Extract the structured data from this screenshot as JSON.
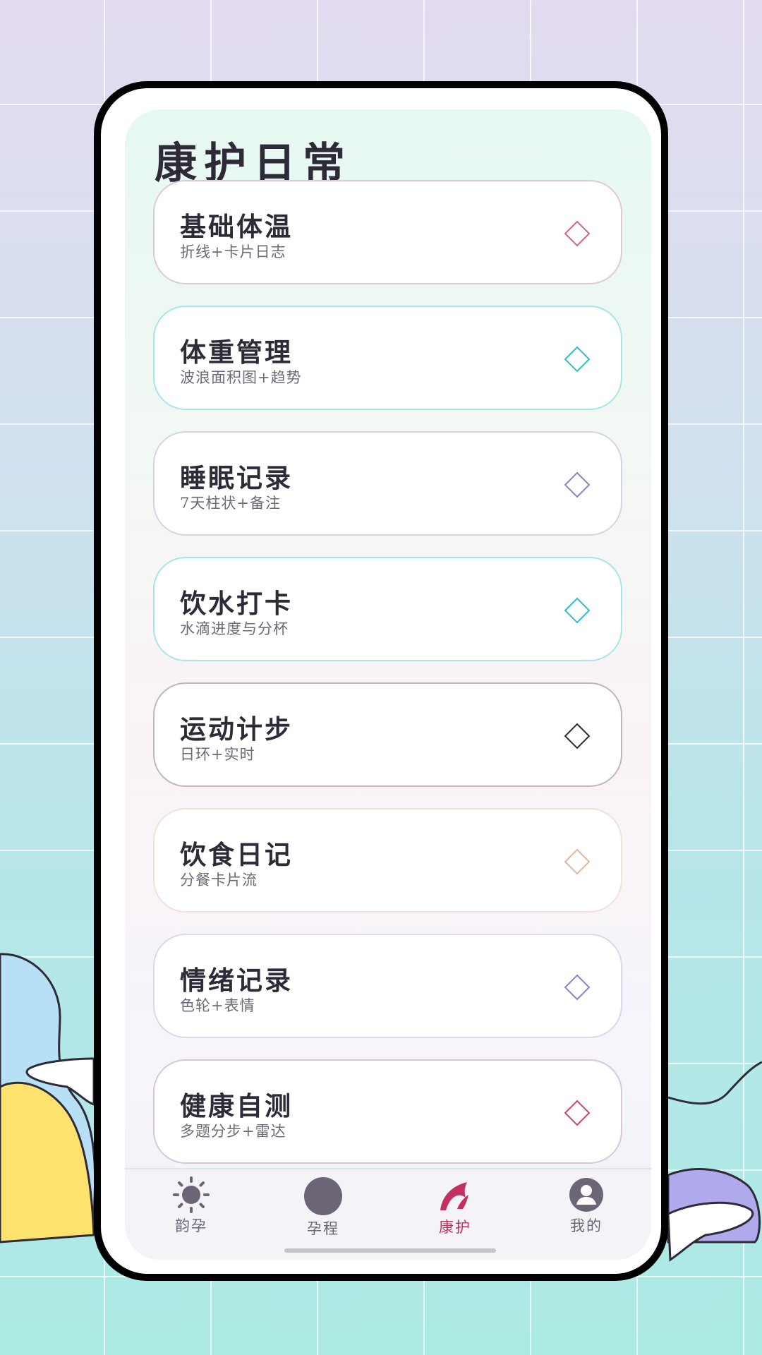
{
  "page_title": "康护日常",
  "cards": [
    {
      "title": "基础体温",
      "subtitle": "折线+卡片日志",
      "border": "#dfc9d8",
      "icon": "diamond-icon",
      "icon_color": "#d26a7c"
    },
    {
      "title": "体重管理",
      "subtitle": "波浪面积图+趋势",
      "border": "#a6e6e8",
      "icon": "diamond-icon",
      "icon_color": "#2fc0c2"
    },
    {
      "title": "睡眠记录",
      "subtitle": "7天柱状+备注",
      "border": "#d7d2e8",
      "icon": "diamond-icon",
      "icon_color": "#8a86c6"
    },
    {
      "title": "饮水打卡",
      "subtitle": "水滴进度与分杯",
      "border": "#a6e6e8",
      "icon": "diamond-icon",
      "icon_color": "#2fc0c2"
    },
    {
      "title": "运动计步",
      "subtitle": "日环+实时",
      "border": "#bdb6c0",
      "icon": "diamond-icon",
      "icon_color": "#2e2a38"
    },
    {
      "title": "饮食日记",
      "subtitle": "分餐卡片流",
      "border": "#f1e2d9",
      "icon": "diamond-icon",
      "icon_color": "#e0b7a0"
    },
    {
      "title": "情绪记录",
      "subtitle": "色轮+表情",
      "border": "#dcd7ea",
      "icon": "diamond-icon",
      "icon_color": "#8a86c6"
    },
    {
      "title": "健康自测",
      "subtitle": "多题分步+雷达",
      "border": "#d9c7d6",
      "icon": "diamond-icon",
      "icon_color": "#c8496a"
    }
  ],
  "tabbar": {
    "tabs": [
      {
        "label": "韵孕",
        "icon": "sun-icon",
        "active": false
      },
      {
        "label": "孕程",
        "icon": "circle-icon",
        "active": false
      },
      {
        "label": "康护",
        "icon": "leaf-icon",
        "active": true
      },
      {
        "label": "我的",
        "icon": "user-icon",
        "active": false
      }
    ]
  },
  "colors": {
    "accent": "#c2305e",
    "text": "#2e2a38",
    "subtext": "#6f6878"
  }
}
